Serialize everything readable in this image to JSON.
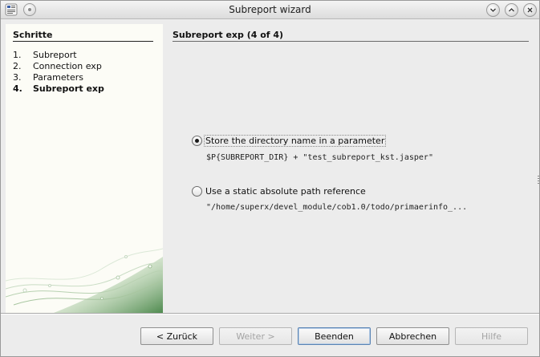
{
  "window": {
    "title": "Subreport wizard",
    "app_icon": "ireport-app-icon",
    "controls": [
      "minimize-icon",
      "maximize-icon",
      "close-icon"
    ]
  },
  "steps": {
    "heading": "Schritte",
    "items": [
      {
        "num": "1.",
        "label": "Subreport"
      },
      {
        "num": "2.",
        "label": "Connection exp"
      },
      {
        "num": "3.",
        "label": "Parameters"
      },
      {
        "num": "4.",
        "label": "Subreport exp"
      }
    ],
    "current_index": 3
  },
  "content": {
    "title": "Subreport exp (4 of 4)",
    "option_parameter": {
      "label": "Store the directory name in a parameter",
      "expression": "$P{SUBREPORT_DIR} + \"test_subreport_kst.jasper\"",
      "selected": true
    },
    "option_static": {
      "label": "Use a static absolute path reference",
      "expression": "\"/home/superx/devel_module/cob1.0/todo/primaerinfo_...",
      "selected": false
    }
  },
  "buttons": {
    "back": "< Zurück",
    "next": "Weiter >",
    "finish": "Beenden",
    "cancel": "Abbrechen",
    "help": "Hilfe"
  },
  "colors": {
    "steps_background": "#fcfcf6",
    "swirl_green": "#4f8a4f",
    "default_button_border": "#5a84b4"
  }
}
